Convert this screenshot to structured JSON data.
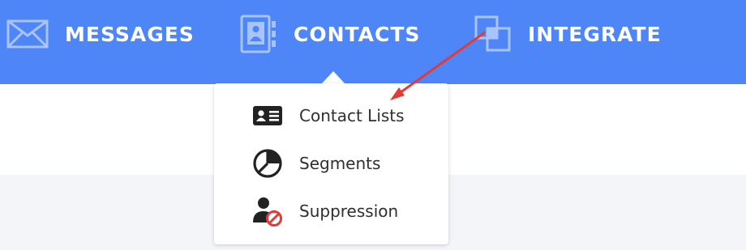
{
  "nav": {
    "messages": {
      "label": "MESSAGES",
      "icon": "envelope-icon"
    },
    "contacts": {
      "label": "CONTACTS",
      "icon": "address-book-icon"
    },
    "integrate": {
      "label": "INTEGRATE",
      "icon": "overlapping-squares-icon"
    }
  },
  "dropdown": {
    "items": [
      {
        "label": "Contact Lists",
        "icon": "id-card-icon"
      },
      {
        "label": "Segments",
        "icon": "pie-chart-icon"
      },
      {
        "label": "Suppression",
        "icon": "user-blocked-icon"
      }
    ]
  },
  "colors": {
    "navbar": "#4f86f7",
    "nav_icon": "#a9c4fb",
    "annotation_arrow": "#e53935",
    "block_red": "#e53935"
  }
}
